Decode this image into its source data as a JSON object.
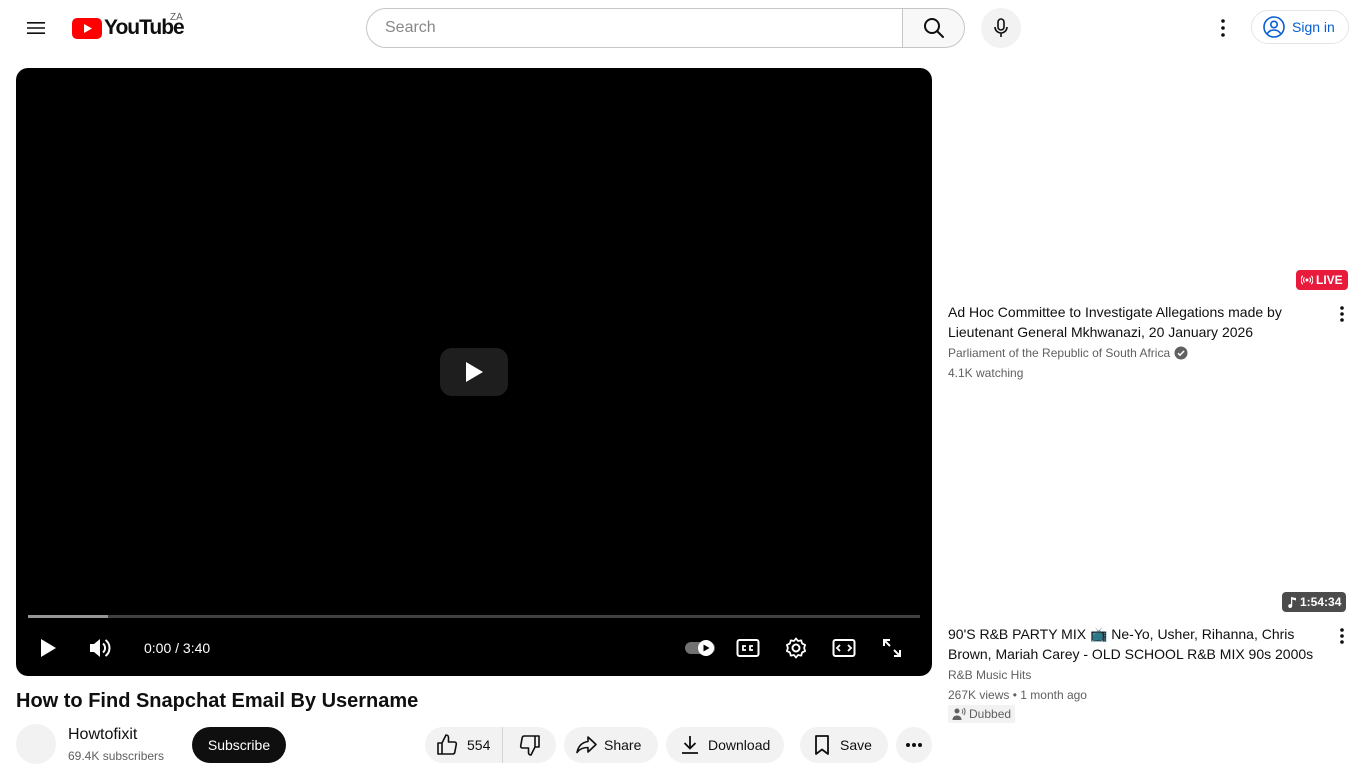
{
  "header": {
    "logo_text": "YouTube",
    "region": "ZA",
    "search_placeholder": "Search",
    "sign_in_label": "Sign in"
  },
  "player": {
    "current_time": "0:00",
    "separator": " / ",
    "duration": "3:40",
    "buffered_fraction": 0.09
  },
  "video": {
    "title": "How to Find Snapchat Email By Username",
    "channel": "Howtofixit",
    "subscribers": "69.4K subscribers",
    "subscribe_label": "Subscribe",
    "likes": "554",
    "share_label": "Share",
    "download_label": "Download",
    "save_label": "Save"
  },
  "recommendations": [
    {
      "badge": "LIVE",
      "title": "Ad Hoc Committee to Investigate Allegations made by Lieutenant General Mkhwanazi, 20 January 2026",
      "channel": "Parliament of the Republic of South Africa",
      "verified": true,
      "meta": "4.1K watching"
    },
    {
      "badge": "1:54:34",
      "title": "90'S R&B PARTY MIX 📺 Ne-Yo, Usher, Rihanna, Chris Brown, Mariah Carey - OLD SCHOOL R&B MIX 90s 2000s",
      "channel": "R&B Music Hits",
      "views": "267K views",
      "dot": "•",
      "age": "1 month ago",
      "tag": "Dubbed"
    }
  ],
  "colors": {
    "brand_red": "#ff0000",
    "live_red": "#e81b3c",
    "link_blue": "#065fd4",
    "player_bg": "#000000"
  }
}
